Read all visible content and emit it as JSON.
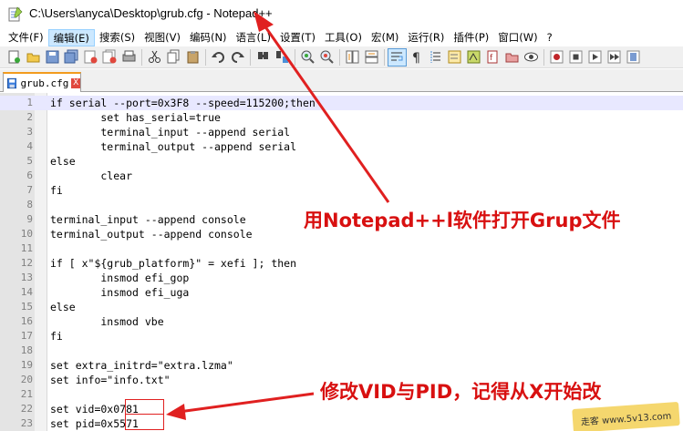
{
  "window": {
    "title": "C:\\Users\\anyca\\Desktop\\grub.cfg - Notepad++"
  },
  "menu": [
    {
      "label": "文件(F)",
      "active": false
    },
    {
      "label": "编辑(E)",
      "active": true
    },
    {
      "label": "搜索(S)",
      "active": false
    },
    {
      "label": "视图(V)",
      "active": false
    },
    {
      "label": "编码(N)",
      "active": false
    },
    {
      "label": "语言(L)",
      "active": false
    },
    {
      "label": "设置(T)",
      "active": false
    },
    {
      "label": "工具(O)",
      "active": false
    },
    {
      "label": "宏(M)",
      "active": false
    },
    {
      "label": "运行(R)",
      "active": false
    },
    {
      "label": "插件(P)",
      "active": false
    },
    {
      "label": "窗口(W)",
      "active": false
    },
    {
      "label": "?",
      "active": false
    }
  ],
  "toolbar_icons": [
    "new-file-icon",
    "open-file-icon",
    "save-icon",
    "save-all-icon",
    "close-icon",
    "close-all-icon",
    "print-icon",
    "sep",
    "cut-icon",
    "copy-icon",
    "paste-icon",
    "sep",
    "undo-icon",
    "redo-icon",
    "sep",
    "find-icon",
    "replace-icon",
    "sep",
    "zoom-in-icon",
    "zoom-out-icon",
    "sep",
    "sync-vertical-icon",
    "sync-horizontal-icon",
    "sep",
    "word-wrap-icon",
    "show-all-chars-icon",
    "indent-guide-icon",
    "user-language-icon",
    "doc-map-icon",
    "function-list-icon",
    "folder-workspace-icon",
    "monitor-icon",
    "sep",
    "record-macro-icon",
    "stop-macro-icon",
    "play-macro-icon",
    "play-multiple-macro-icon",
    "save-macro-icon"
  ],
  "tab": {
    "label": "grub.cfg",
    "close": "X"
  },
  "editor": {
    "lines": [
      {
        "num": "1",
        "code": "if serial --port=0x3F8 --speed=115200;then"
      },
      {
        "num": "2",
        "code": "        set has_serial=true"
      },
      {
        "num": "3",
        "code": "        terminal_input --append serial"
      },
      {
        "num": "4",
        "code": "        terminal_output --append serial"
      },
      {
        "num": "5",
        "code": "else"
      },
      {
        "num": "6",
        "code": "        clear"
      },
      {
        "num": "7",
        "code": "fi"
      },
      {
        "num": "8",
        "code": ""
      },
      {
        "num": "9",
        "code": "terminal_input --append console"
      },
      {
        "num": "10",
        "code": "terminal_output --append console"
      },
      {
        "num": "11",
        "code": ""
      },
      {
        "num": "12",
        "code": "if [ x\"${grub_platform}\" = xefi ]; then"
      },
      {
        "num": "13",
        "code": "        insmod efi_gop"
      },
      {
        "num": "14",
        "code": "        insmod efi_uga"
      },
      {
        "num": "15",
        "code": "else"
      },
      {
        "num": "16",
        "code": "        insmod vbe"
      },
      {
        "num": "17",
        "code": "fi"
      },
      {
        "num": "18",
        "code": ""
      },
      {
        "num": "19",
        "code": "set extra_initrd=\"extra.lzma\""
      },
      {
        "num": "20",
        "code": "set info=\"info.txt\""
      },
      {
        "num": "21",
        "code": ""
      },
      {
        "num": "22",
        "code": "set vid=0x0781"
      },
      {
        "num": "23",
        "code": "set pid=0x5571"
      }
    ]
  },
  "annotations": {
    "open_hint": "用Notepad++l软件打开Grup文件",
    "edit_hint": "修改VID与PID，记得从X开始改"
  },
  "watermark": {
    "text": "走客 www.5v13.com"
  },
  "colors": {
    "annotation_red": "#d81010",
    "tab_accent": "#f29b1d",
    "current_line": "#e8e8ff"
  }
}
